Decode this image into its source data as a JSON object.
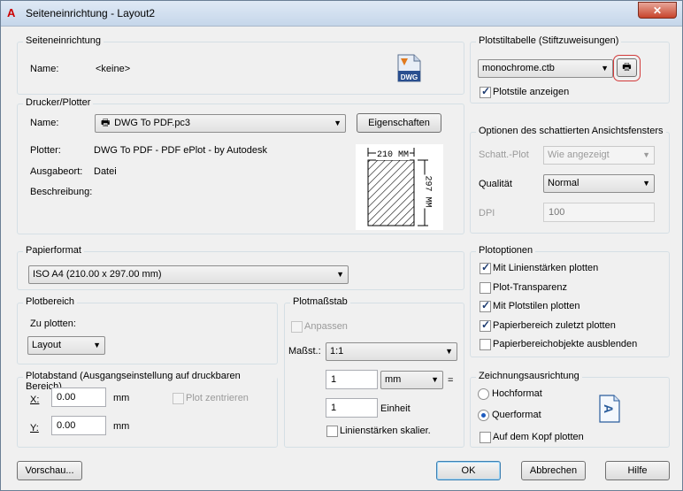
{
  "window": {
    "title": "Seiteneinrichtung - Layout2",
    "close_glyph": "✕"
  },
  "page_setup": {
    "group_label": "Seiteneinrichtung",
    "name_label": "Name:",
    "name_value": "<keine>",
    "dwg_icon_text": "DWG"
  },
  "printer": {
    "group_label": "Drucker/Plotter",
    "name_label": "Name:",
    "name_value": "DWG To PDF.pc3",
    "properties_button": "Eigenschaften",
    "plotter_label": "Plotter:",
    "plotter_value": "DWG To PDF - PDF ePlot - by Autodesk",
    "output_label": "Ausgabeort:",
    "output_value": "Datei",
    "description_label": "Beschreibung:",
    "preview_width_label": "210 MM",
    "preview_height_label": "297 MM"
  },
  "paper_size": {
    "group_label": "Papierformat",
    "value": "ISO A4 (210.00 x 297.00 mm)"
  },
  "plot_area": {
    "group_label": "Plotbereich",
    "what_label": "Zu plotten:",
    "what_value": "Layout"
  },
  "plot_offset": {
    "group_label": "Plotabstand (Ausgangseinstellung auf druckbaren Bereich)",
    "x_label": "X:",
    "x_value": "0.00",
    "x_unit": "mm",
    "y_label": "Y:",
    "y_value": "0.00",
    "y_unit": "mm",
    "center_label": "Plot zentrieren"
  },
  "plot_scale": {
    "group_label": "Plotmaßstab",
    "fit_label": "Anpassen",
    "scale_label": "Maßst.:",
    "scale_value": "1:1",
    "value1": "1",
    "unit_value": "mm",
    "equals": "=",
    "value2": "1",
    "unit_label": "Einheit",
    "scale_lineweights_label": "Linienstärken skalier."
  },
  "plot_style_table": {
    "group_label": "Plotstiltabelle (Stiftzuweisungen)",
    "value": "monochrome.ctb",
    "display_label": "Plotstile anzeigen"
  },
  "shaded_viewport": {
    "group_label": "Optionen des schattierten Ansichtsfensters",
    "shade_label": "Schatt.-Plot",
    "shade_value": "Wie angezeigt",
    "quality_label": "Qualität",
    "quality_value": "Normal",
    "dpi_label": "DPI",
    "dpi_value": "100"
  },
  "plot_options": {
    "group_label": "Plotoptionen",
    "items": [
      {
        "label": "Mit Linienstärken plotten",
        "checked": true
      },
      {
        "label": "Plot-Transparenz",
        "checked": false
      },
      {
        "label": "Mit Plotstilen plotten",
        "checked": true
      },
      {
        "label": "Papierbereich zuletzt plotten",
        "checked": true
      },
      {
        "label": "Papierbereichobjekte ausblenden",
        "checked": false
      }
    ]
  },
  "orientation": {
    "group_label": "Zeichnungsausrichtung",
    "portrait_label": "Hochformat",
    "landscape_label": "Querformat",
    "upside_down_label": "Auf dem Kopf plotten",
    "icon_letter": "A"
  },
  "footer": {
    "preview_button": "Vorschau...",
    "ok_button": "OK",
    "cancel_button": "Abbrechen",
    "help_button": "Hilfe"
  },
  "colors": {
    "accent_ring": "#d23a3a",
    "title_icon": "#cc0000"
  }
}
